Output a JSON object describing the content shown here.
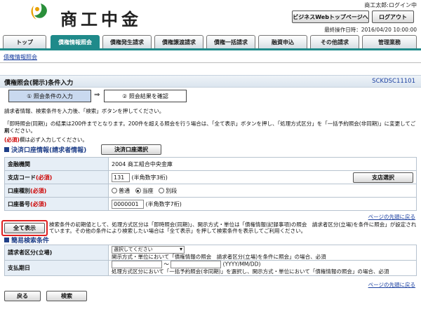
{
  "header": {
    "logo_text": "商工中金",
    "user": "商工太郎:ログイン中",
    "top_page_button": "ビジネスWebトップページへ",
    "logout_button": "ログアウト",
    "last_operation": "最終操作日時：2016/04/20 10:00:00"
  },
  "tabs": [
    {
      "label": "トップ"
    },
    {
      "label": "債権情報照会"
    },
    {
      "label": "債権発生請求"
    },
    {
      "label": "債権譲渡請求"
    },
    {
      "label": "債権一括請求"
    },
    {
      "label": "融資申込"
    },
    {
      "label": "その他請求"
    },
    {
      "label": "管理業務"
    }
  ],
  "subnav": "債権情報照会",
  "page": {
    "title": "債権照会(開示)条件入力",
    "screen_id": "SCKDSC11101"
  },
  "steps": {
    "step1": "① 照会条件の入力",
    "arrow": "⇒",
    "step2": "② 照会結果を確認"
  },
  "instructions": {
    "line1": "請求者情報、検索条件を入力後、「検索」ボタンを押してください。",
    "line2": "「即時照会(同期)」の結果は200件までとなります。200件を超える照会を行う場合は、「全て表示」ボタンを押し、「処理方式区分」を「一括予約照会(非同期)」に変更してご利",
    "line3": "用ください。",
    "required_mark": "(必須)",
    "required_note": "欄は必ず入力してください。"
  },
  "settlement_section": {
    "title": "決済口座情報(請求者情報)",
    "select_button": "決済口座選択",
    "rows": {
      "bank_label": "金融機関",
      "bank_value": "2004  商工組合中央金庫",
      "branch_label": "支店コード",
      "branch_value": "131",
      "branch_hint": "(半角数字3桁)",
      "branch_button": "支店選択",
      "type_label": "口座種別",
      "type_options": [
        "普通",
        "当座",
        "別段"
      ],
      "type_selected": "当座",
      "number_label": "口座番号",
      "number_value": "0000001",
      "number_hint": "(半角数字7桁)"
    },
    "required": "(必須)"
  },
  "page_top_link": "ページの先頭に戻る",
  "show_all": {
    "button": "全て表示",
    "text": "検索条件の初期値として、処理方式区分は「即時照会(同期)」、開示方式・単位は「債権情報(記録事項)の照会　請求者区分(立場)を条件に照会」が設定されています。その他の条件により検索したい場合は「全て表示」を押して検索条件を表示してご利用ください。"
  },
  "simple_search": {
    "title": "簡易検索条件",
    "requester_label": "請求者区分(立場)",
    "requester_select": "選択してください",
    "requester_note": "開示方式・単位において「債権情報の照会　請求者区分(立場)を条件に照会」の場合、必須",
    "due_label": "支払期日",
    "due_separator": "〜",
    "due_format": "(YYYY/MM/DD)",
    "due_note": "処理方式区分において「一括予約照会(非同期)」を選択し、開示方式・単位において「債権情報の照会」の場合、必須"
  },
  "buttons": {
    "back": "戻る",
    "search": "検索"
  },
  "colors": {
    "accent": "#1f8a8a",
    "section": "#1f3f88",
    "required": "#cc0000",
    "highlight": "#e02020"
  }
}
